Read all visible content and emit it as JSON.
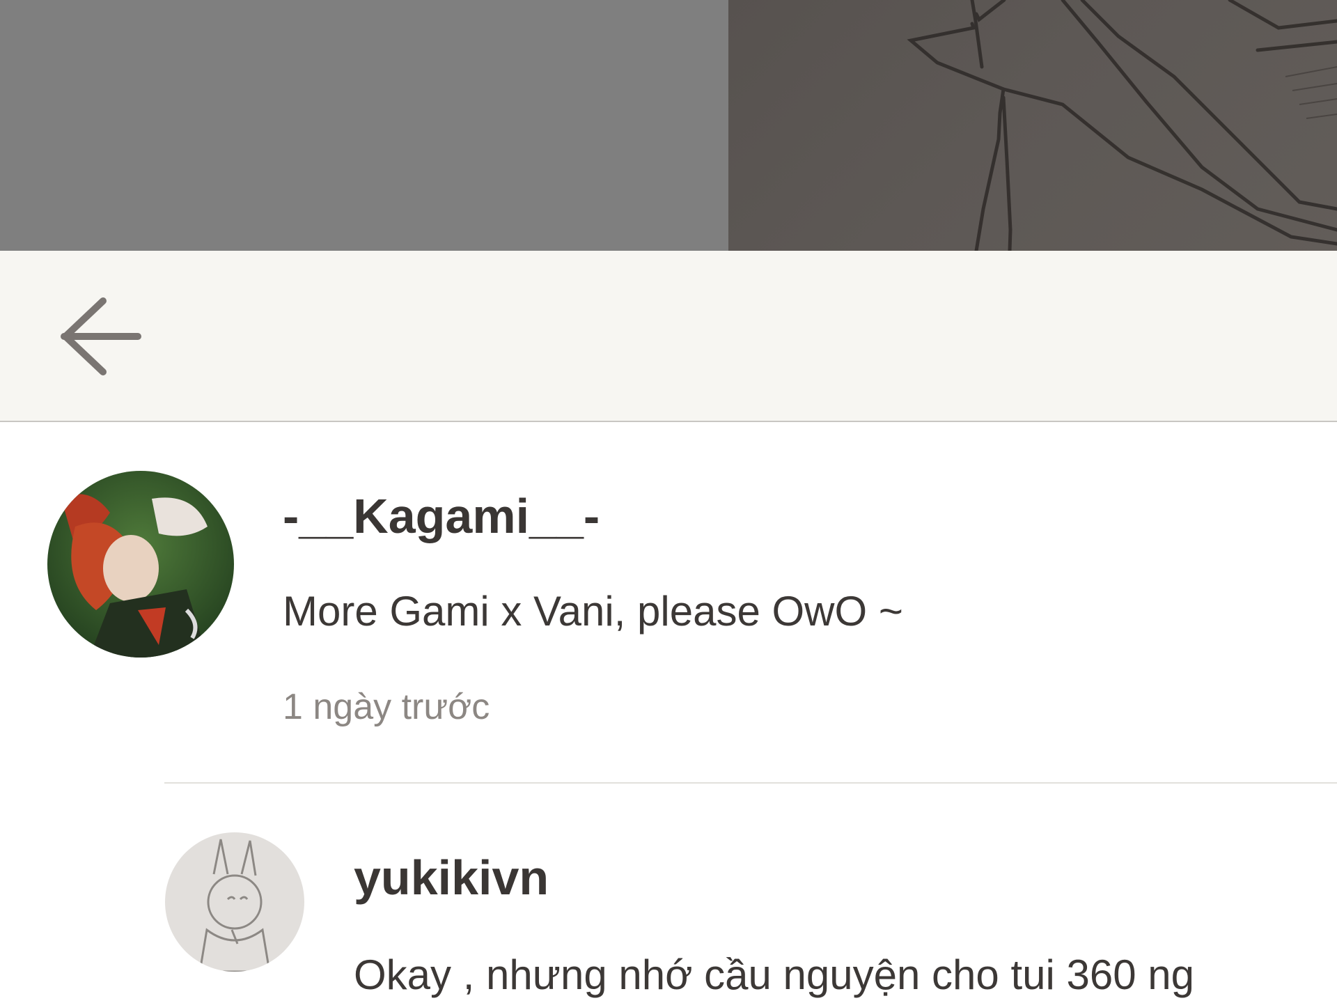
{
  "header": {
    "back_icon": "arrow-left-icon"
  },
  "comments": [
    {
      "author": "-__Kagami__-",
      "text": "More Gami x Vani, please OwO ~",
      "time": "1 ngày trước"
    },
    {
      "author": "yukikivn",
      "text": "Okay , nhưng nhớ cầu nguyện cho tui 360 ng"
    }
  ],
  "colors": {
    "header_bg": "#f7f6f2",
    "author_text": "#3a3634",
    "time_text": "#8c8783"
  }
}
